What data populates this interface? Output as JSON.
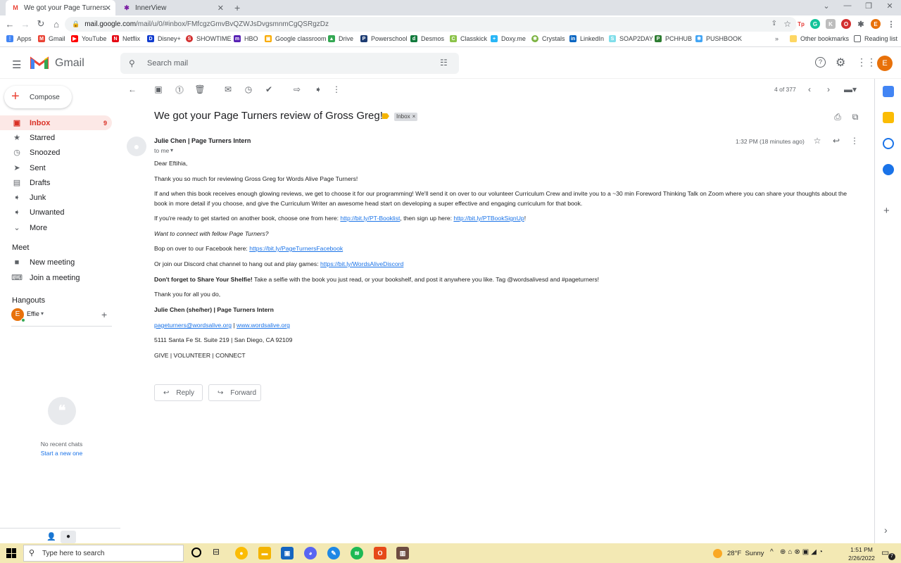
{
  "browser": {
    "tabs": [
      {
        "title": "We got your Page Turners review",
        "active": true
      },
      {
        "title": "InnerView",
        "active": false
      }
    ],
    "url_host": "mail.google.com",
    "url_path": "/mail/u/0/#inbox/FMfcgzGmvBvQZWJsDvgsmnmCgQSRgzDz",
    "bookmarks": [
      "Apps",
      "Gmail",
      "YouTube",
      "Netflix",
      "Disney+",
      "SHOWTIME",
      "HBO",
      "Google classroom",
      "Drive",
      "Powerschool",
      "Desmos",
      "Classkick",
      "Doxy.me",
      "Crystals",
      "LinkedIn",
      "SOAP2DAY",
      "PCHHUB",
      "PUSHBOOK"
    ],
    "other_bookmarks": "Other bookmarks",
    "reading_list": "Reading list",
    "profile_initial": "E"
  },
  "gmail": {
    "logo_text": "Gmail",
    "search_placeholder": "Search mail",
    "compose": "Compose",
    "nav": [
      {
        "label": "Inbox",
        "count": "9"
      },
      {
        "label": "Starred",
        "count": ""
      },
      {
        "label": "Snoozed",
        "count": ""
      },
      {
        "label": "Sent",
        "count": ""
      },
      {
        "label": "Drafts",
        "count": ""
      },
      {
        "label": "Junk",
        "count": ""
      },
      {
        "label": "Unwanted",
        "count": ""
      },
      {
        "label": "More",
        "count": ""
      }
    ],
    "meet_title": "Meet",
    "meet_items": [
      "New meeting",
      "Join a meeting"
    ],
    "hangouts_title": "Hangouts",
    "hangouts_user": "Effie",
    "no_recent": "No recent chats",
    "start_new": "Start a new one",
    "pager": "4 of 377"
  },
  "email": {
    "subject": "We got your Page Turners review of Gross Greg!",
    "label": "Inbox",
    "sender": "Julie Chen | Page Turners Intern",
    "to": "to me",
    "time": "1:32 PM (18 minutes ago)",
    "greeting": "Dear Eftihia,",
    "p1": "Thank you so much for reviewing Gross Greg for Words Alive Page Turners!",
    "p2": "If and when this book receives enough glowing reviews, we get to choose it for our programming! We'll send it on over to our volunteer Curriculum Crew and invite you to a ~30 min Foreword Thinking Talk on Zoom where you can share your thoughts about the book in more detail if you choose, and give the Curriculum Writer an awesome head start on developing a super effective and engaging curriculum for that book.",
    "p3_a": "If you're ready to get started on another book, choose one from here: ",
    "p3_link1": "http://bit.ly/PT-Booklist",
    "p3_b": ", then sign up here: ",
    "p3_link2": "http://bit.ly/PTBookSignUp",
    "p3_c": "!",
    "p4": "Want to connect with fellow Page Turners?",
    "p5_a": "Bop on over to our Facebook here: ",
    "p5_link": "https://bit.ly/PageTurnersFacebook",
    "p6_a": "Or join our Discord chat channel to hang out and play games: ",
    "p6_link": "https://bit.ly/WordsAliveDiscord",
    "p7_bold": "Don't forget to Share Your Shelfie!",
    "p7_rest": " Take a selfie with the book you just read, or your bookshelf, and post it anywhere you like. Tag @wordsalivesd and #pageturners!",
    "p8": "Thank you for all you do,",
    "sig_name": "Julie Chen (she/her) | Page Turners Intern",
    "sig_email": "pageturners@wordsalive.org",
    "sig_sep": " | ",
    "sig_web": "www.wordsalive.org",
    "address": "5111 Santa Fe St. Suite 219 | San Diego, CA 92109",
    "tagline": "GIVE | VOLUNTEER | CONNECT",
    "reply": "Reply",
    "forward": "Forward"
  },
  "taskbar": {
    "search_placeholder": "Type here to search",
    "weather": "28°F  Sunny",
    "time": "1:51 PM",
    "date": "2/26/2022",
    "notif": "7"
  }
}
